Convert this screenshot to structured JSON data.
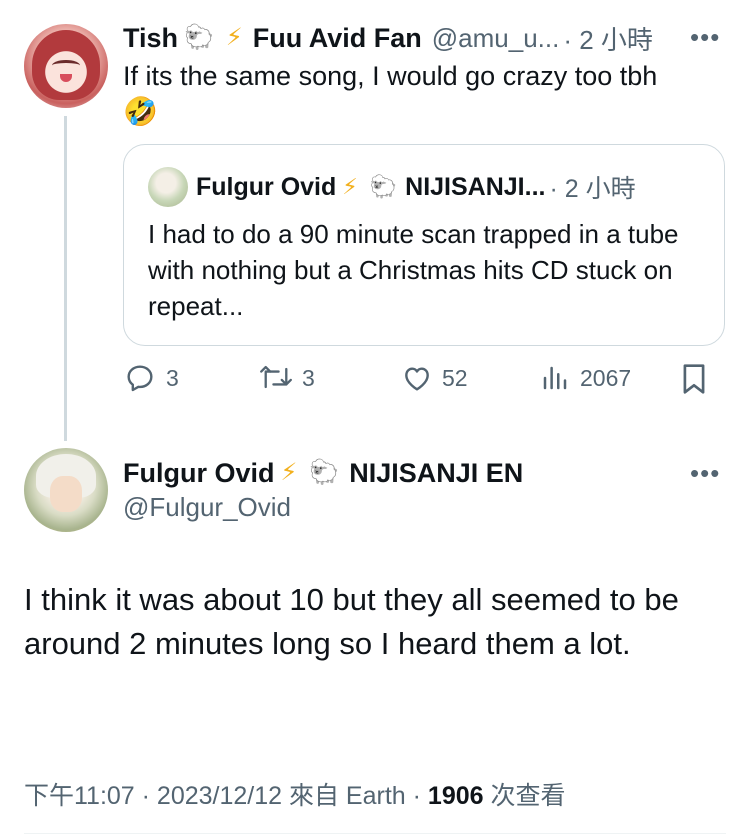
{
  "reply": {
    "name": "Tish",
    "badge_emojis": [
      "🐑",
      "⚡"
    ],
    "name_suffix": "Fuu Avid Fan",
    "handle": "@amu_u...",
    "time": "· 2 小時",
    "text_line1": "If its the same song, I would go crazy too tbh",
    "text_emoji": "🤣",
    "quote": {
      "name": "Fulgur Ovid",
      "badge_emojis": [
        "⚡",
        "🐑"
      ],
      "org": "NIJISANJI...",
      "time": "· 2 小時",
      "text": "I had to do a 90 minute scan trapped in a tube with nothing but a Christmas hits CD stuck on repeat..."
    },
    "actions": {
      "replies": "3",
      "reposts": "3",
      "likes": "52",
      "views": "2067"
    }
  },
  "main": {
    "name": "Fulgur Ovid",
    "badge_emojis": [
      "⚡",
      "🐑"
    ],
    "org": "NIJISANJI EN",
    "handle": "@Fulgur_Ovid",
    "text": "I think it was about 10 but they all seemed to be around 2 minutes long so I heard them a lot.",
    "meta_time": "下午11:07 · 2023/12/12 來自 Earth · ",
    "meta_views": "1906",
    "meta_views_label": " 次查看"
  },
  "icons": {
    "more": "more-icon",
    "reply": "reply-icon",
    "repost": "repost-icon",
    "like": "like-icon",
    "views": "views-icon",
    "bookmark": "bookmark-icon"
  },
  "colors": {
    "text": "#0f1419",
    "secondary": "#536471",
    "border": "#cfd9de",
    "bolt": "#f2b01e"
  }
}
